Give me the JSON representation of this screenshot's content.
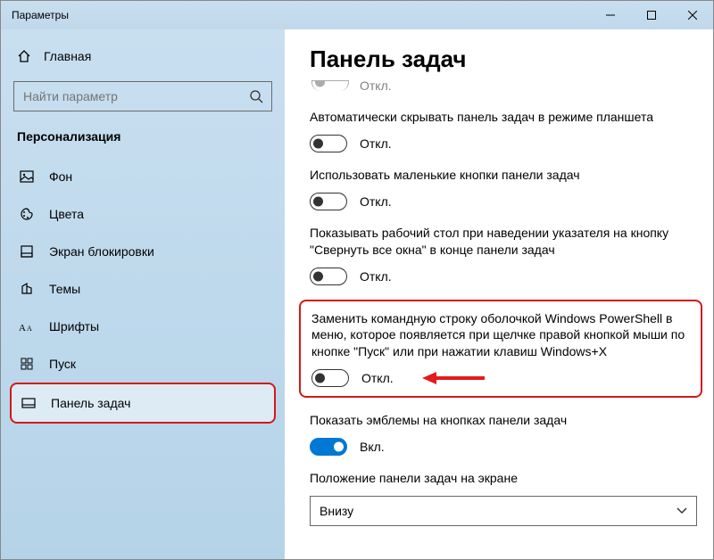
{
  "window": {
    "title": "Параметры"
  },
  "sidebar": {
    "home": "Главная",
    "search_placeholder": "Найти параметр",
    "category": "Персонализация",
    "items": [
      {
        "label": "Фон"
      },
      {
        "label": "Цвета"
      },
      {
        "label": "Экран блокировки"
      },
      {
        "label": "Темы"
      },
      {
        "label": "Шрифты"
      },
      {
        "label": "Пуск"
      },
      {
        "label": "Панель задач"
      }
    ]
  },
  "main": {
    "title": "Панель задач",
    "cut_label": "Откл.",
    "settings": [
      {
        "label": "Автоматически скрывать панель задач в режиме планшета",
        "state": "Откл.",
        "on": false
      },
      {
        "label": "Использовать маленькие кнопки панели задач",
        "state": "Откл.",
        "on": false
      },
      {
        "label": "Показывать рабочий стол при наведении указателя на кнопку \"Свернуть все окна\" в конце панели задач",
        "state": "Откл.",
        "on": false
      },
      {
        "label": "Заменить командную строку оболочкой Windows PowerShell в меню, которое появляется при щелчке правой кнопкой мыши по кнопке \"Пуск\" или при нажатии клавиш Windows+X",
        "state": "Откл.",
        "on": false,
        "highlight": true
      },
      {
        "label": "Показать эмблемы на кнопках панели задач",
        "state": "Вкл.",
        "on": true
      }
    ],
    "position": {
      "label": "Положение панели задач на экране",
      "value": "Внизу"
    }
  }
}
